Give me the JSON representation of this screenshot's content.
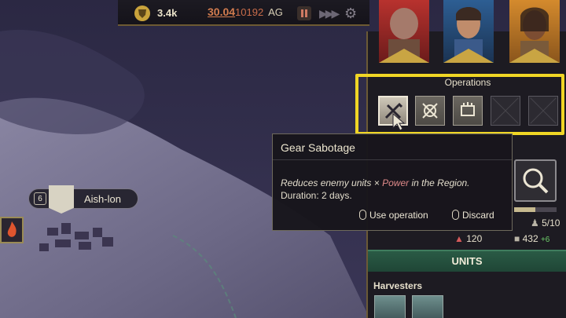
{
  "topbar": {
    "currency_icon": "shield-coin-icon",
    "currency": "3.4k",
    "date_main": "30.04",
    "date_sub": "10192",
    "date_era": "AG",
    "pause_icon": "pause-icon",
    "fast_forward_icon": "fast-forward-icon",
    "settings_icon": "gear-icon"
  },
  "map": {
    "region_level": "6",
    "region_name": "Aish-lon"
  },
  "operations": {
    "title": "Operations",
    "slots": [
      {
        "icon": "gear-sabotage-icon",
        "state": "selected"
      },
      {
        "icon": "crossed-target-icon",
        "state": "available"
      },
      {
        "icon": "crown-shield-icon",
        "state": "available"
      },
      {
        "icon": "empty-slot-icon",
        "state": "empty"
      },
      {
        "icon": "empty-slot-icon",
        "state": "empty"
      }
    ]
  },
  "tooltip": {
    "title": "Gear Sabotage",
    "desc_prefix": "Reduces enemy units",
    "desc_symbol": "×",
    "desc_power": "Power",
    "desc_suffix": "in the Region.",
    "duration": "Duration: 2 days.",
    "use_label": "Use operation",
    "discard_label": "Discard"
  },
  "panel": {
    "slider_fill": 0.5,
    "capacity": "5/10",
    "resource_a": "120",
    "resource_b": "432",
    "resource_b_delta": "+6",
    "units_label": "UNITS",
    "harvesters_label": "Harvesters"
  },
  "colors": {
    "highlight": "#f0d625",
    "power": "#e08a8a",
    "date": "#d27c4f",
    "positive": "#6fcf6b"
  }
}
